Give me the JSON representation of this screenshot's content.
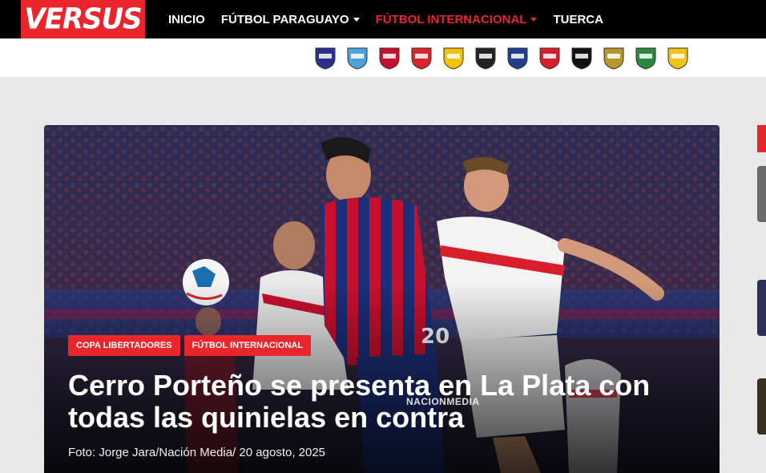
{
  "brand": {
    "logo_text": "VERSUS",
    "accent": "#e8262c"
  },
  "nav": {
    "items": [
      {
        "label": "INICIO",
        "dropdown": false,
        "active": false
      },
      {
        "label": "FÚTBOL PARAGUAYO",
        "dropdown": true,
        "active": false
      },
      {
        "label": "FÚTBOL INTERNACIONAL",
        "dropdown": true,
        "active": true
      },
      {
        "label": "TUERCA",
        "dropdown": false,
        "active": false
      }
    ]
  },
  "clubs": [
    {
      "icon": "club-crest-1",
      "color": "#2d2f8f"
    },
    {
      "icon": "club-crest-2",
      "color": "#4aa3dd"
    },
    {
      "icon": "club-crest-3",
      "color": "#c8102e"
    },
    {
      "icon": "club-crest-4",
      "color": "#d9262c"
    },
    {
      "icon": "club-crest-5",
      "color": "#f4c300"
    },
    {
      "icon": "club-crest-6",
      "color": "#222222"
    },
    {
      "icon": "club-crest-7",
      "color": "#1f3f8f"
    },
    {
      "icon": "club-crest-8",
      "color": "#d81e2b"
    },
    {
      "icon": "club-crest-9",
      "color": "#111111"
    },
    {
      "icon": "club-crest-10",
      "color": "#b8962e"
    },
    {
      "icon": "club-crest-11",
      "color": "#2a8a3c"
    },
    {
      "icon": "club-crest-12",
      "color": "#f0c419"
    }
  ],
  "hero": {
    "tags": [
      "COPA LIBERTADORES",
      "FÚTBOL INTERNACIONAL"
    ],
    "headline": "Cerro Porteño se presenta en La Plata con todas las quinielas en contra",
    "caption": "Foto: Jorge Jara/Nación Media/ 20 agosto, 2025",
    "watermark": "NACIONMEDIA"
  }
}
